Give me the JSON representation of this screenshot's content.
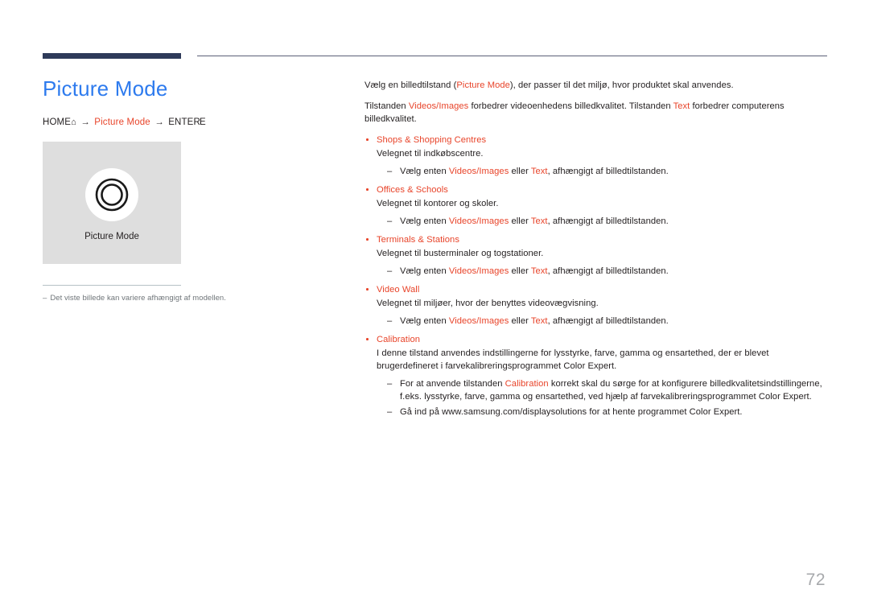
{
  "header": {
    "rule_color_thick": "#2e3a59",
    "rule_color_thin": "#5b5f77"
  },
  "left": {
    "title": "Picture Mode",
    "breadcrumb": {
      "home_label": "HOME",
      "home_icon": "home-icon",
      "arrow": "→",
      "menu_label": "Picture Mode",
      "enter_label": "ENTER",
      "enter_icon": "enter-key-icon"
    },
    "preview": {
      "icon": "concentric-circles-icon",
      "caption": "Picture Mode"
    },
    "note": {
      "dash": "–",
      "text": "Det viste billede kan variere afhængigt af modellen."
    }
  },
  "right": {
    "intro": {
      "p1_a": "Vælg en billedtilstand (",
      "p1_accent": "Picture Mode",
      "p1_b": "), der passer til det miljø, hvor produktet skal anvendes.",
      "p2_a": "Tilstanden ",
      "p2_accent1": "Videos/Images",
      "p2_b": " forbedrer videoenhedens billedkvalitet. Tilstanden ",
      "p2_accent2": "Text",
      "p2_c": " forbedrer computerens billedkvalitet."
    },
    "sub_common": {
      "dash": "–",
      "a": "Vælg enten ",
      "accent1": "Videos/Images",
      "b": " eller ",
      "accent2": "Text",
      "c": ", afhængigt af billedtilstanden."
    },
    "bullets": [
      {
        "title": "Shops & Shopping Centres",
        "desc": "Velegnet til indkøbscentre."
      },
      {
        "title": "Offices & Schools",
        "desc": "Velegnet til kontorer og skoler."
      },
      {
        "title": "Terminals & Stations",
        "desc": "Velegnet til busterminaler og togstationer."
      },
      {
        "title": "Video Wall",
        "desc": "Velegnet til miljøer, hvor der benyttes videovægvisning."
      }
    ],
    "calibration": {
      "title": "Calibration",
      "desc": "I denne tilstand anvendes indstillingerne for lysstyrke, farve, gamma og ensartethed, der er blevet brugerdefineret i farvekalibreringsprogrammet Color Expert.",
      "sub1_dash": "–",
      "sub1_a": "For at anvende tilstanden ",
      "sub1_accent": "Calibration",
      "sub1_b": " korrekt skal du sørge for at konfigurere billedkvalitetsindstillingerne, f.eks. lysstyrke, farve, gamma og ensartethed, ved hjælp af farvekalibreringsprogrammet Color Expert.",
      "sub2_dash": "–",
      "sub2_text": "Gå ind på www.samsung.com/displaysolutions for at hente programmet Color Expert."
    }
  },
  "footer": {
    "page_number": "72"
  }
}
